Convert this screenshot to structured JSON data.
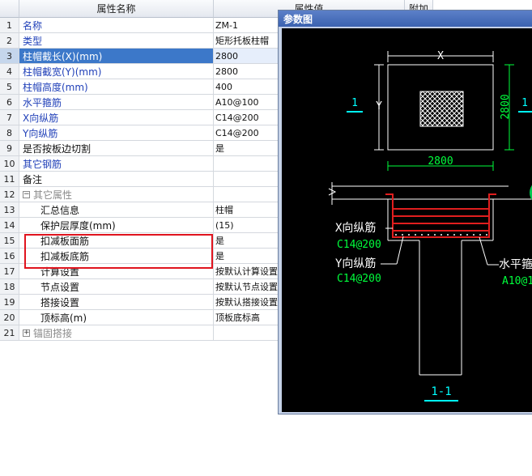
{
  "grid": {
    "header_name": "属性名称",
    "header_value": "属性值",
    "header_extra": "附加",
    "rows": [
      {
        "num": "1",
        "name": "名称",
        "value": "ZM-1",
        "color": "blue",
        "indent": 0
      },
      {
        "num": "2",
        "name": "类型",
        "value": "矩形托板柱帽",
        "color": "blue",
        "indent": 0
      },
      {
        "num": "3",
        "name": "柱帽截长(X)(mm)",
        "value": "2800",
        "color": "blue",
        "indent": 0,
        "selected": true
      },
      {
        "num": "4",
        "name": "柱帽截宽(Y)(mm)",
        "value": "2800",
        "color": "blue",
        "indent": 0
      },
      {
        "num": "5",
        "name": "柱帽高度(mm)",
        "value": "400",
        "color": "blue",
        "indent": 0
      },
      {
        "num": "6",
        "name": "水平箍筋",
        "value": "A10@100",
        "color": "blue",
        "indent": 0
      },
      {
        "num": "7",
        "name": "X向纵筋",
        "value": "C14@200",
        "color": "blue",
        "indent": 0
      },
      {
        "num": "8",
        "name": "Y向纵筋",
        "value": "C14@200",
        "color": "blue",
        "indent": 0
      },
      {
        "num": "9",
        "name": "是否按板边切割",
        "value": "是",
        "color": "black",
        "indent": 0
      },
      {
        "num": "10",
        "name": "其它钢筋",
        "value": "",
        "color": "blue",
        "indent": 0
      },
      {
        "num": "11",
        "name": "备注",
        "value": "",
        "color": "black",
        "indent": 0
      },
      {
        "num": "12",
        "name": "其它属性",
        "value": "",
        "color": "gray",
        "indent": 0,
        "tree": "−"
      },
      {
        "num": "13",
        "name": "汇总信息",
        "value": "柱帽",
        "color": "black",
        "indent": 1
      },
      {
        "num": "14",
        "name": "保护层厚度(mm)",
        "value": "(15)",
        "color": "black",
        "indent": 1
      },
      {
        "num": "15",
        "name": "扣减板面筋",
        "value": "是",
        "color": "black",
        "indent": 1
      },
      {
        "num": "16",
        "name": "扣减板底筋",
        "value": "是",
        "color": "black",
        "indent": 1
      },
      {
        "num": "17",
        "name": "计算设置",
        "value": "按默认计算设置",
        "color": "black",
        "indent": 1
      },
      {
        "num": "18",
        "name": "节点设置",
        "value": "按默认节点设置",
        "color": "black",
        "indent": 1
      },
      {
        "num": "19",
        "name": "搭接设置",
        "value": "按默认搭接设置",
        "color": "black",
        "indent": 1
      },
      {
        "num": "20",
        "name": "顶标高(m)",
        "value": "顶板底标高",
        "color": "black",
        "indent": 1
      },
      {
        "num": "21",
        "name": "锚固搭接",
        "value": "",
        "color": "gray",
        "indent": 0,
        "tree": "+"
      }
    ]
  },
  "dialog": {
    "title": "参数图",
    "plan": {
      "x_label": "X",
      "y_label": "Y",
      "width_dim": "2800",
      "height_dim": "2800",
      "section_mark": "1"
    },
    "section": {
      "x_rebar_label": "X向纵筋",
      "x_rebar_value": "C14@200",
      "y_rebar_label": "Y向纵筋",
      "y_rebar_value": "C14@200",
      "stirrup_label": "水平箍",
      "stirrup_value": "A10@1",
      "section_name": "1-1"
    },
    "colors": {
      "rebar": "#e01e1e",
      "dimension": "#00ff3c",
      "label": "#00ffff",
      "line": "#ffffff"
    }
  }
}
